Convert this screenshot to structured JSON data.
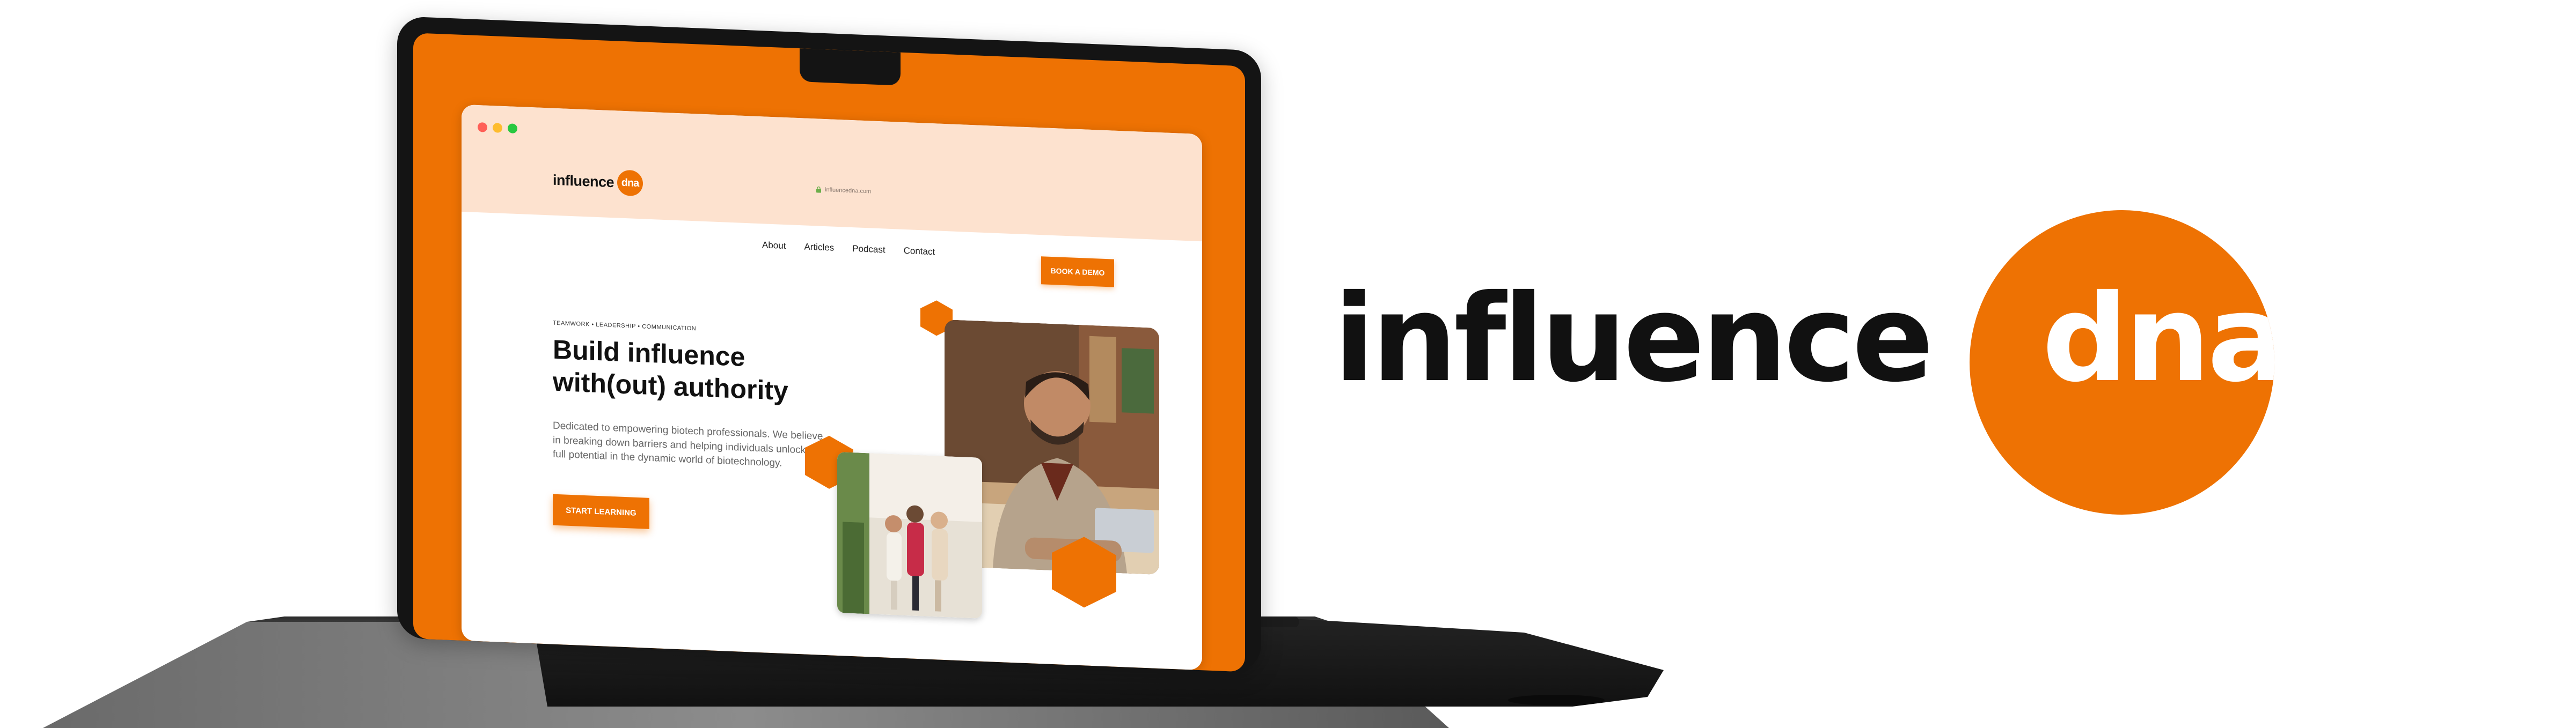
{
  "site": {
    "logo_word": "influence",
    "logo_badge": "dna",
    "url": "influencedna.com",
    "nav": [
      "About",
      "Articles",
      "Podcast",
      "Contact"
    ],
    "cta_demo": "BOOK A DEMO"
  },
  "hero": {
    "eyebrow": "TEAMWORK • LEADERSHIP • COMMUNICATION",
    "headline_line1": "Build influence",
    "headline_line2": "with(out) authority",
    "body": "Dedicated to empowering biotech professionals. We believe in breaking down barriers and helping individuals unlock their full potential in the dynamic world of biotechnology.",
    "cta_start": "START LEARNING"
  },
  "brand": {
    "word": "influence",
    "badge": "dna"
  },
  "colors": {
    "accent": "#ee7203",
    "text_dark": "#111111"
  },
  "icons": {
    "lock": "lock-icon"
  }
}
